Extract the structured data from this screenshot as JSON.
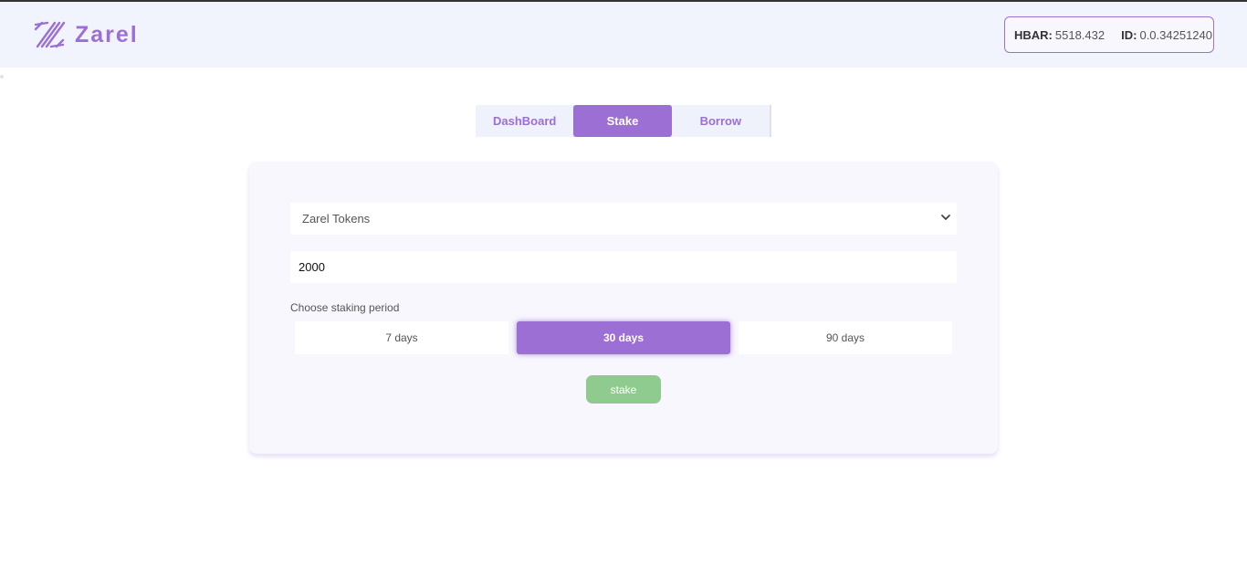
{
  "brand": {
    "name": "Zarel",
    "logo_icon": "zarel-logo-icon",
    "accent_color": "#9b6fd3"
  },
  "wallet": {
    "hbar_label": "HBAR:",
    "hbar_value": "5518.432",
    "id_label": "ID:",
    "id_value": "0.0.34251240"
  },
  "tabs": [
    {
      "label": "DashBoard",
      "active": false
    },
    {
      "label": "Stake",
      "active": true
    },
    {
      "label": "Borrow",
      "active": false
    }
  ],
  "stake_form": {
    "token_select": {
      "selected": "Zarel Tokens",
      "icon": "chevron-down-icon"
    },
    "amount_value": "2000",
    "period_label": "Choose staking period",
    "periods": [
      {
        "label": "7 days",
        "selected": false
      },
      {
        "label": "30 days",
        "selected": true
      },
      {
        "label": "90 days",
        "selected": false
      }
    ],
    "stake_button": "stake",
    "stake_button_color": "#8fcb8f"
  }
}
